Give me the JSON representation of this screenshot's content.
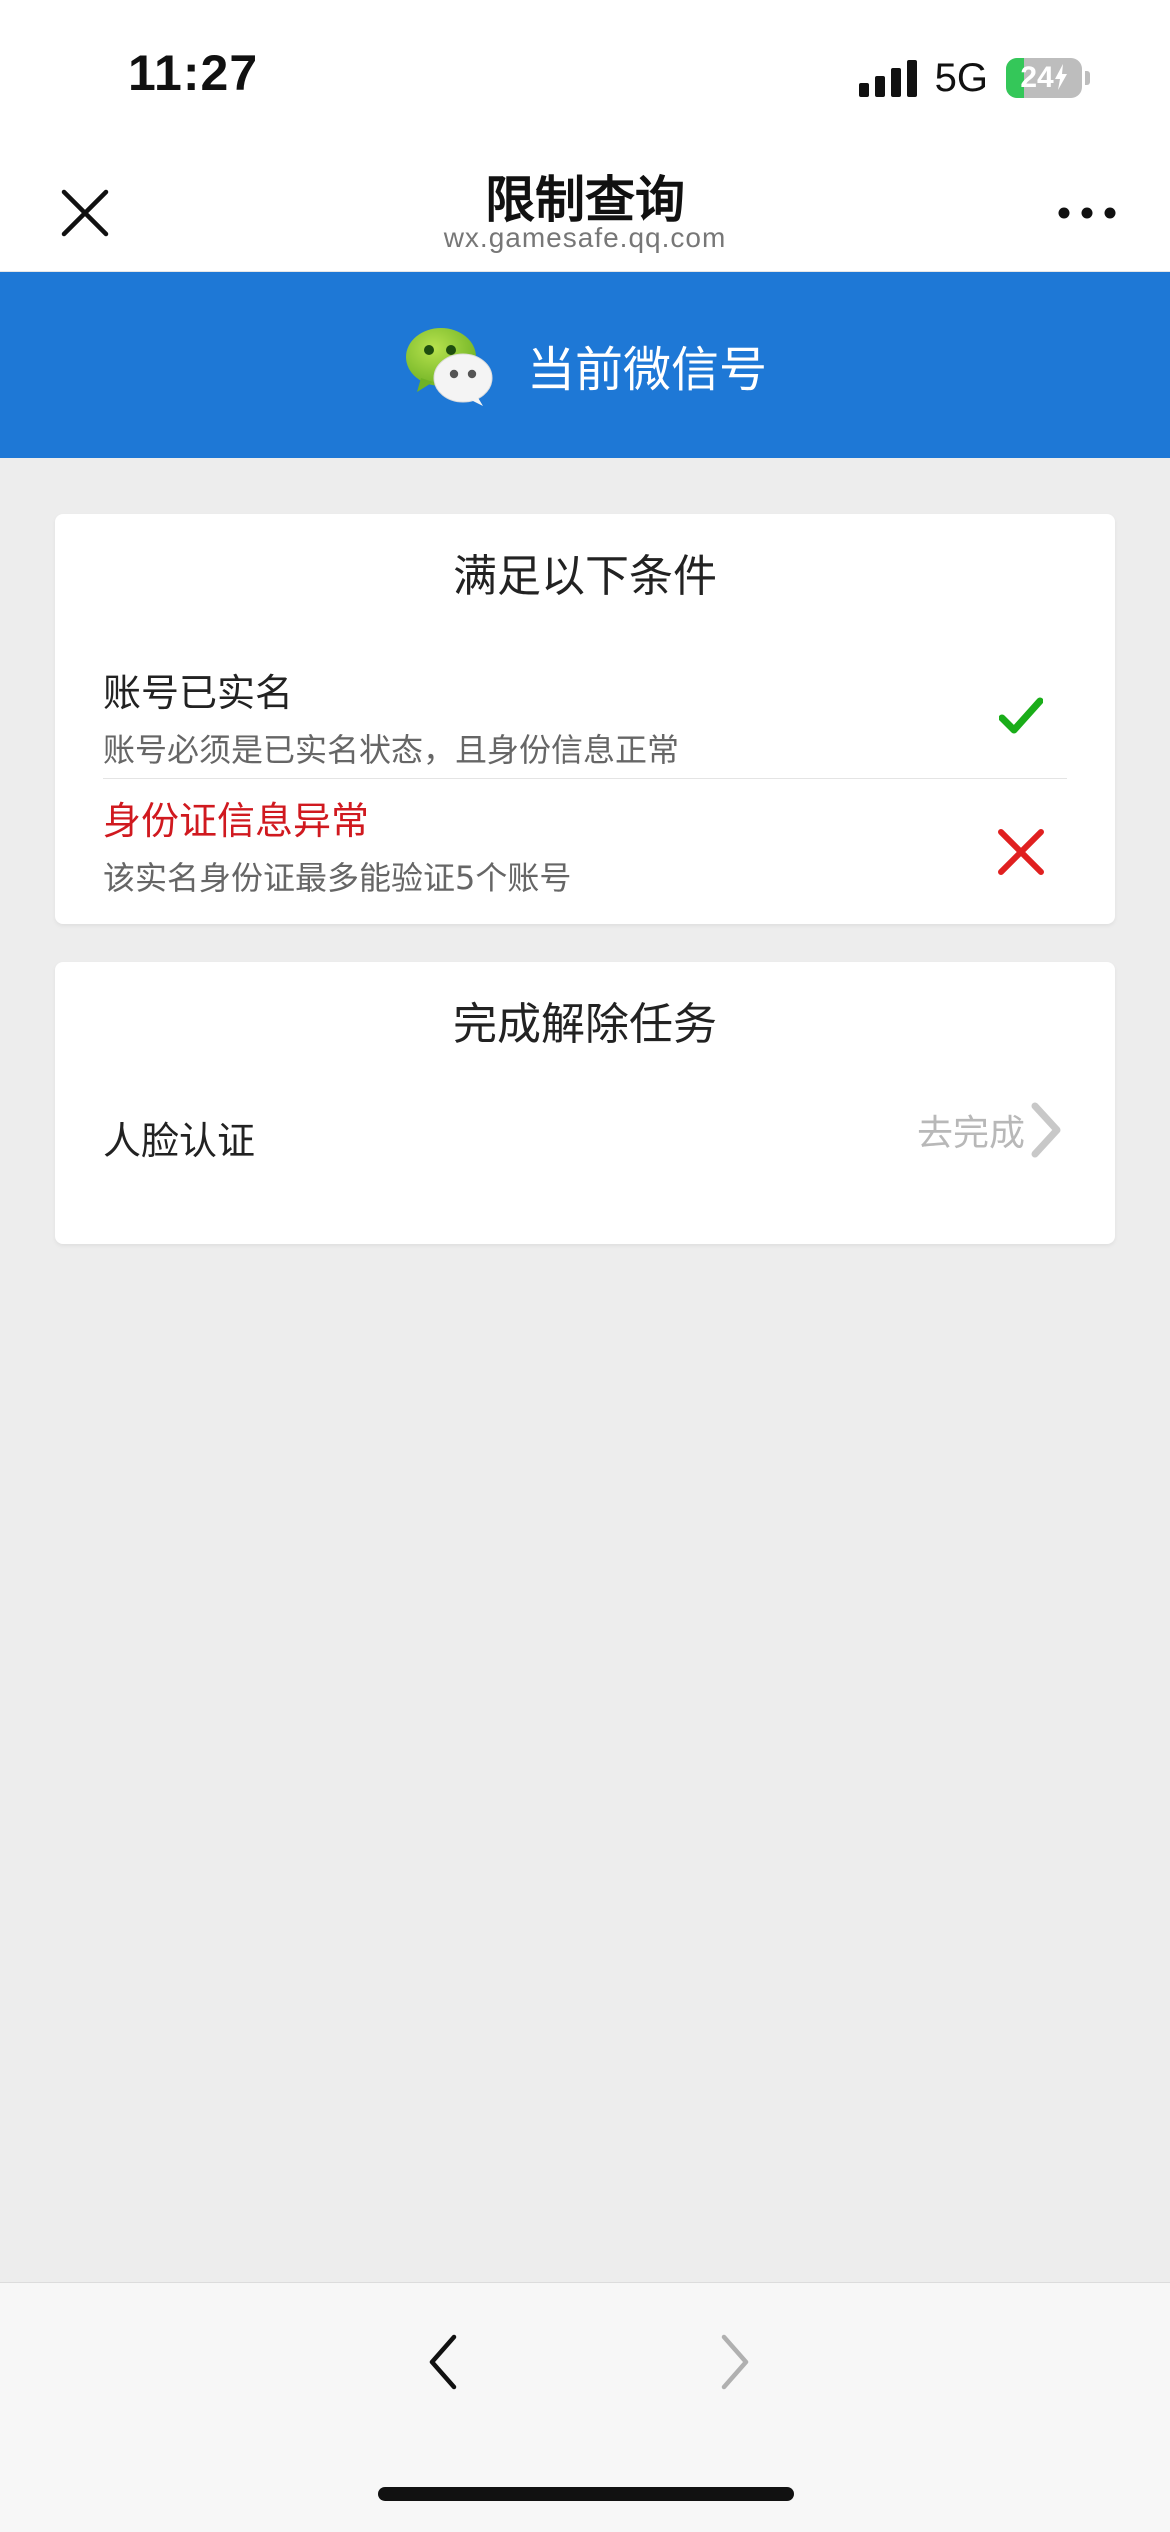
{
  "status_bar": {
    "time": "11:27",
    "network": "5G",
    "battery_level": "24",
    "battery_fraction": 0.24,
    "signal_icon": "signal-bars-icon",
    "battery_icon": "battery-charging-icon"
  },
  "title_bar": {
    "title": "限制查询",
    "url": "wx.gamesafe.qq.com",
    "close_icon": "close-icon",
    "more_icon": "more-dots-icon"
  },
  "banner": {
    "text": "当前微信号",
    "icon": "wechat-logo-icon",
    "color": "#1e78d6"
  },
  "conditions_card": {
    "title": "满足以下条件",
    "items": [
      {
        "title": "账号已实名",
        "description": "账号必须是已实名状态，且身份信息正常",
        "status": "ok",
        "icon": "check-icon",
        "color": "#1aad19"
      },
      {
        "title": "身份证信息异常",
        "description": "该实名身份证最多能验证5个账号",
        "status": "error",
        "icon": "cross-icon",
        "color": "#e02020"
      }
    ]
  },
  "tasks_card": {
    "title": "完成解除任务",
    "task_label": "人脸认证",
    "action_label": "去完成",
    "action_icon": "chevron-right-icon"
  },
  "toolbar": {
    "back_icon": "chevron-left-icon",
    "forward_icon": "chevron-right-icon"
  }
}
